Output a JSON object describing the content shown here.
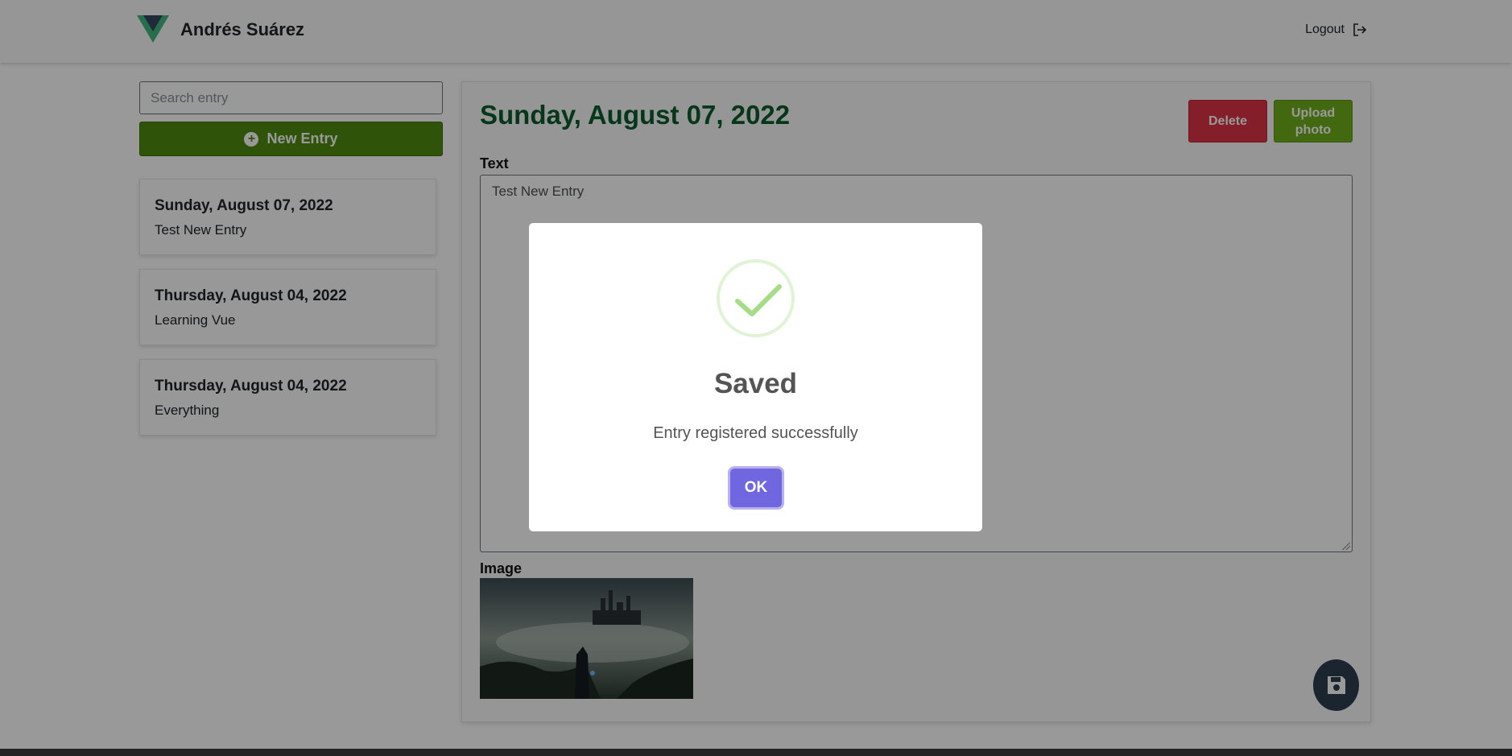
{
  "navbar": {
    "user_name": "Andrés Suárez",
    "logout_label": "Logout",
    "logo_icon": "vue-logo-icon",
    "logout_icon": "logout-arrow-icon"
  },
  "sidebar": {
    "search_placeholder": "Search entry",
    "new_entry_label": "New Entry",
    "new_entry_icon": "plus-circle-icon",
    "entries": [
      {
        "date": "Sunday, August 07, 2022",
        "text": "Test New Entry"
      },
      {
        "date": "Thursday, August 04, 2022",
        "text": "Learning Vue"
      },
      {
        "date": "Thursday, August 04, 2022",
        "text": "Everything"
      }
    ]
  },
  "main": {
    "date": "Sunday, August 07, 2022",
    "delete_label": "Delete",
    "upload_label": "Upload photo",
    "text_label": "Text",
    "text_value": "Test New Entry",
    "image_label": "Image",
    "save_icon": "floppy-disk-icon"
  },
  "modal": {
    "title": "Saved",
    "message": "Entry registered successfully",
    "ok_label": "OK",
    "icon": "success-check-icon"
  },
  "colors": {
    "brand_green": "#0d5c2e",
    "new_entry_bg": "#4f8a10",
    "delete_bg": "#dc3545",
    "upload_bg": "#6fb01a",
    "ok_bg": "#7066e0",
    "save_fab_bg": "#2c3e50"
  }
}
